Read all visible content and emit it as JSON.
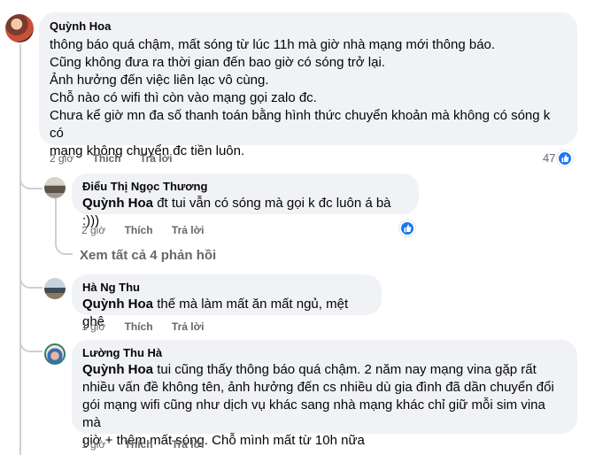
{
  "colors": {
    "bubble": "#f0f2f5",
    "like_blue": "#1877f2",
    "secondary_text": "#65676b",
    "thread_line": "#ccd0d5"
  },
  "main_comment": {
    "author": "Quỳnh Hoa",
    "lines": [
      "thông báo quá chậm, mất sóng từ lúc 11h mà giờ nhà mạng mới thông báo.",
      "Cũng không đưa ra thời gian đến bao giờ có sóng trở lại.",
      "Ảnh hưởng đến việc liên lạc vô cùng.",
      "Chỗ nào có wifi thì còn vào mạng gọi zalo đc.",
      "Chưa kể giờ mn đa số thanh toán bằng hình thức chuyển khoản mà không có sóng k có",
      "mạng không chuyển đc tiền luôn."
    ],
    "time": "2 giờ",
    "like_label": "Thích",
    "reply_label": "Trả lời",
    "reaction_icon": "like-icon",
    "reaction_count": "47"
  },
  "replies": [
    {
      "author": "Điểu Thị Ngọc Thương",
      "mention": "Quỳnh Hoa",
      "lines": [
        "đt tui vẫn có sóng mà gọi k đc luôn á bà :)))"
      ],
      "time": "2 giờ",
      "like_label": "Thích",
      "reply_label": "Trả lời",
      "reaction_icon": "like-icon"
    }
  ],
  "see_all_replies": "Xem tất cả 4 phản hồi",
  "comments": [
    {
      "author": "Hà Ng Thu",
      "mention": "Quỳnh Hoa",
      "lines": [
        "thế mà làm mất ăn mất ngủ, mệt ghê"
      ],
      "time": "1 giờ",
      "like_label": "Thích",
      "reply_label": "Trả lời"
    },
    {
      "author": "Lường Thu Hà",
      "mention": "Quỳnh Hoa",
      "lines": [
        "tui cũng thấy thông báo quá chậm. 2 năm nay mạng vina gặp rất",
        "nhiều vấn đề không tên, ảnh hưởng đến cs nhiều dù gia đình đã dần chuyển đổi",
        "gói mạng wifi cũng như dịch vụ khác sang nhà mạng khác chỉ giữ mỗi sim vina mà",
        "giờ + thêm mất sóng. Chỗ mình mất từ 10h nữa"
      ],
      "time": "1 giờ",
      "like_label": "Thích",
      "reply_label": "Trả lời"
    }
  ]
}
